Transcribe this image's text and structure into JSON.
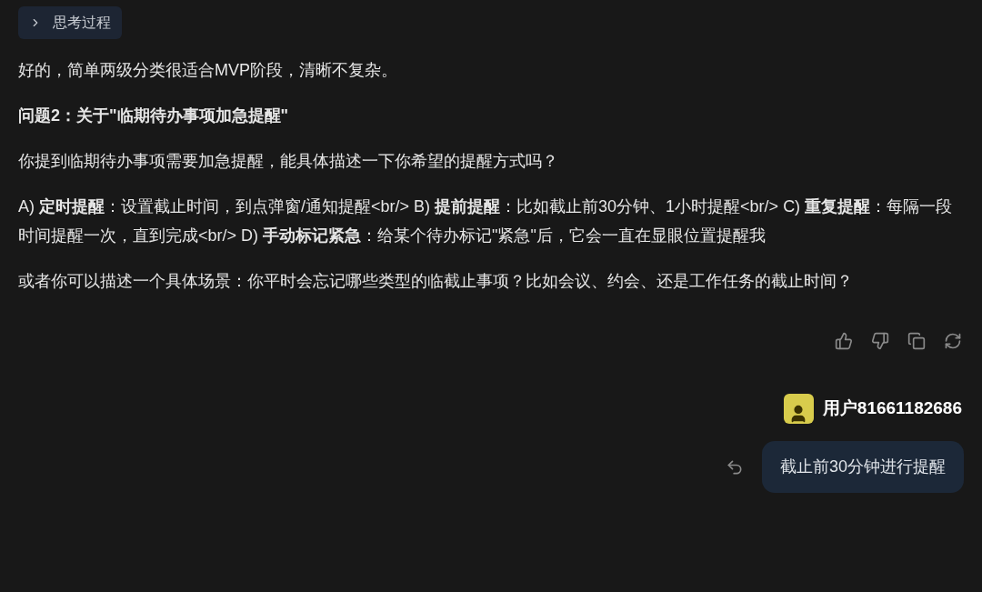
{
  "thinking_toggle": {
    "label": "思考过程",
    "expanded": false
  },
  "paragraphs": [
    {
      "kind": "plain",
      "text": "好的，简单两级分类很适合MVP阶段，清晰不复杂。"
    },
    {
      "kind": "heading",
      "text": "问题2：关于\"临期待办事项加急提醒\""
    },
    {
      "kind": "plain",
      "text": "你提到临期待办事项需要加急提醒，能具体描述一下你希望的提醒方式吗？"
    },
    {
      "kind": "plain",
      "text": "A) **定时提醒**：设置截止时间，到点弹窗/通知提醒<br/> B) **提前提醒**：比如截止前30分钟、1小时提醒<br/> C) **重复提醒**：每隔一段时间提醒一次，直到完成<br/> D) **手动标记紧急**：给某个待办标记\"紧急\"后，它会一直在显眼位置提醒我"
    },
    {
      "kind": "plain",
      "text": "或者你可以描述一个具体场景：你平时会忘记哪些类型的临截止事项？比如会议、约会、还是工作任务的截止时间？"
    }
  ],
  "user": {
    "name": "用户81661182686",
    "message": "截止前30分钟进行提醒"
  }
}
